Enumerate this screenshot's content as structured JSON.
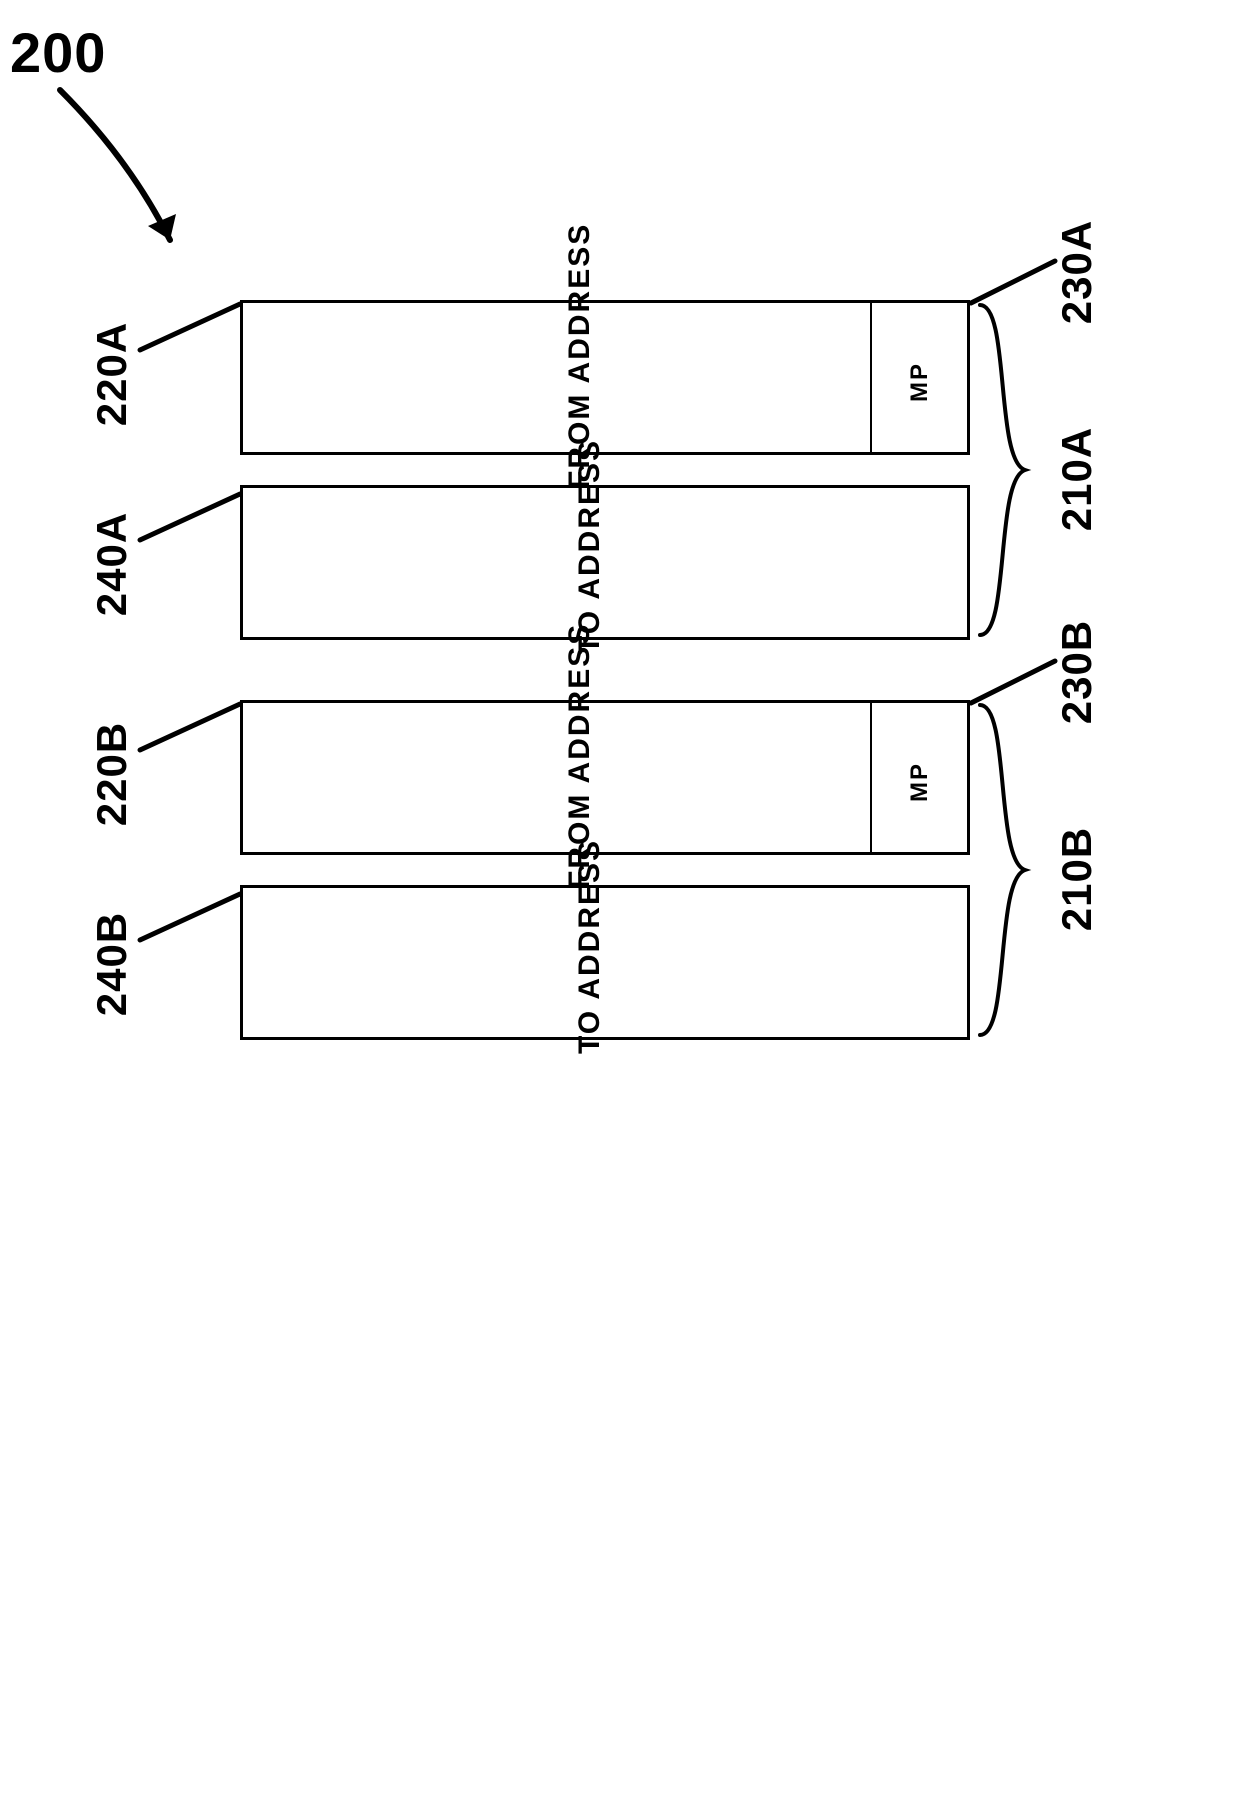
{
  "figure_ref": "200",
  "entries": [
    {
      "from_label": "FROM ADDRESS",
      "to_label": "TO ADDRESS",
      "mp_label": "MP",
      "ref_from_row": "220A",
      "ref_to_row": "240A",
      "ref_mp_cell": "230A",
      "ref_brace": "210A"
    },
    {
      "from_label": "FROM ADDRESS",
      "to_label": "TO ADDRESS",
      "mp_label": "MP",
      "ref_from_row": "220B",
      "ref_to_row": "240B",
      "ref_mp_cell": "230B",
      "ref_brace": "210B"
    }
  ]
}
